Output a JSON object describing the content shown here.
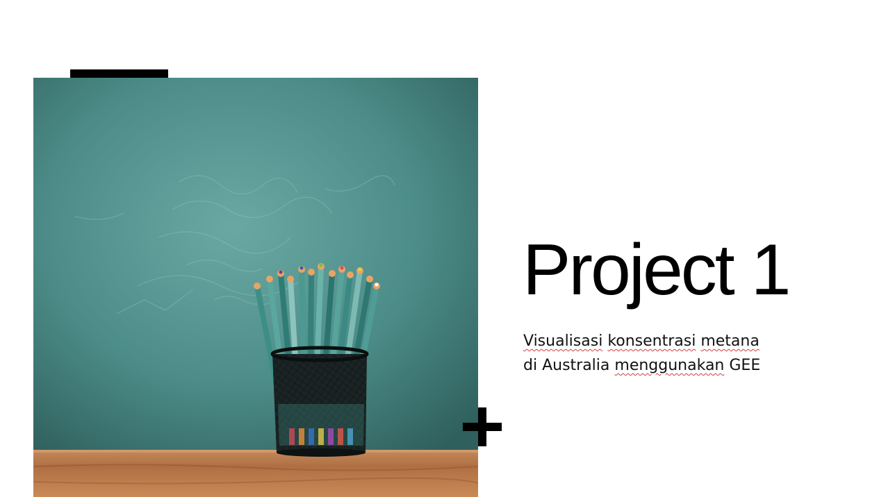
{
  "slide": {
    "title": "Project 1",
    "subtitle": {
      "line1": [
        "Visualisasi",
        " ",
        "konsentrasi",
        " ",
        "metana"
      ],
      "line2_prefix": "di Australia ",
      "line2_word": "menggunakan",
      "line2_suffix": " GEE"
    }
  },
  "colors": {
    "chalkboard": "#4a8a86",
    "desk": "#b9784a",
    "accent": "#000000",
    "spellcheck": "#d23c3c"
  },
  "icons": {
    "plus": "plus-icon"
  }
}
